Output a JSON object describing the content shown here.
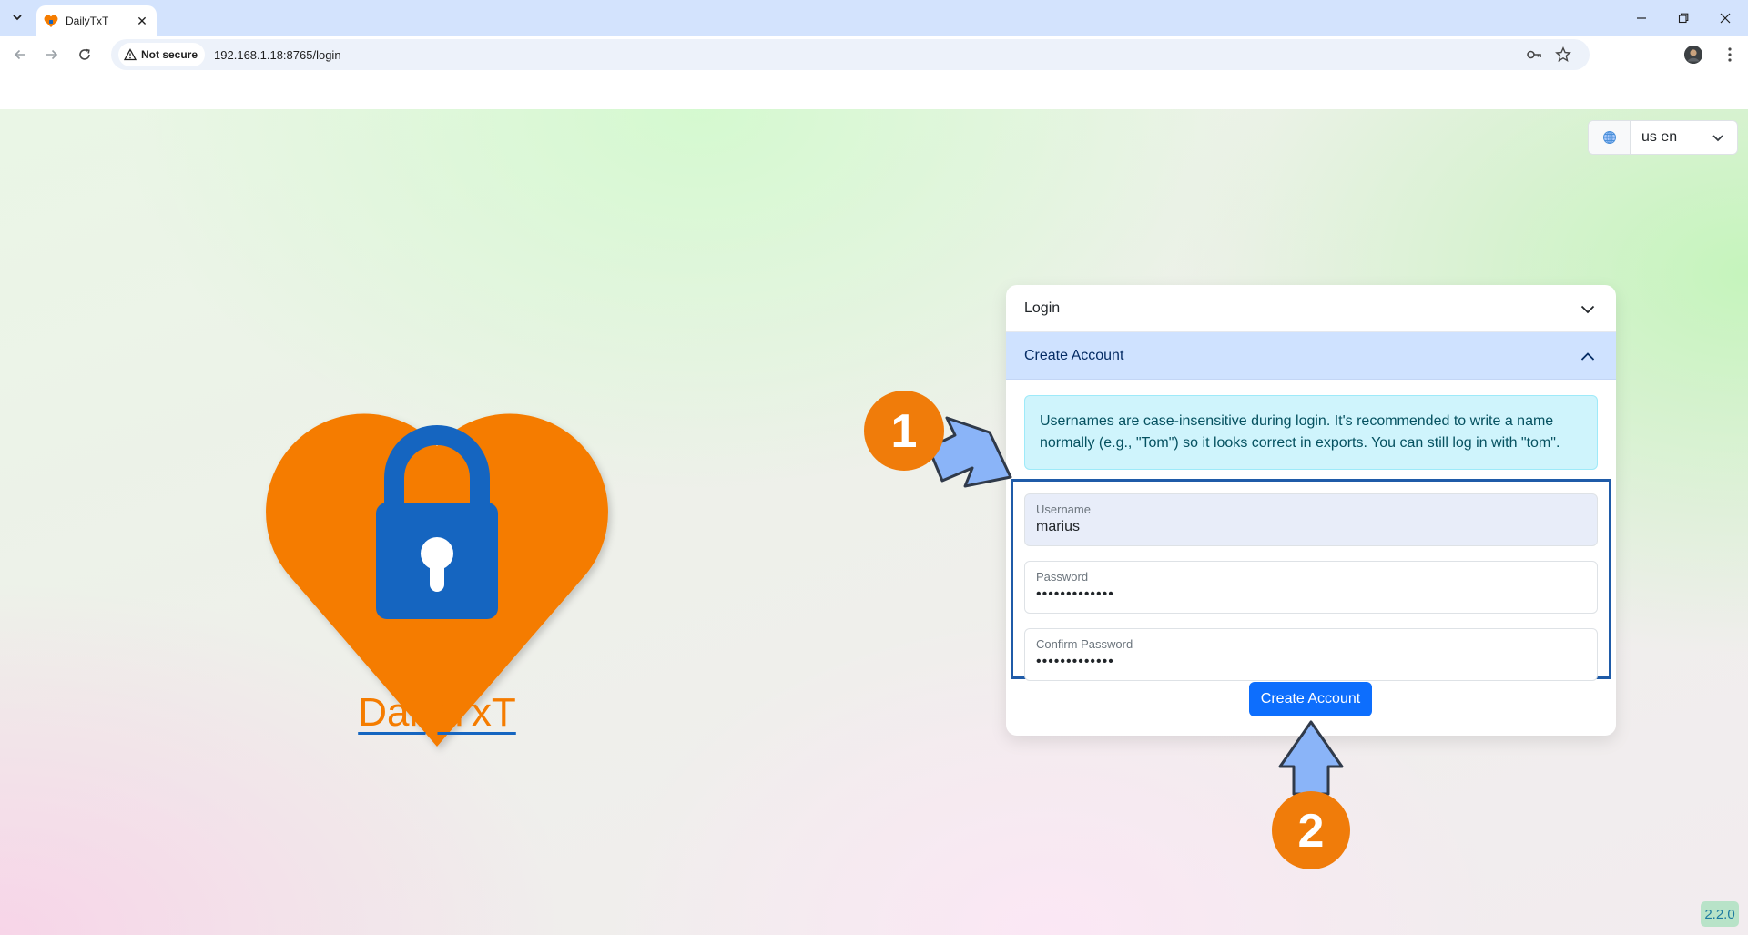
{
  "browser": {
    "tab_title": "DailyTxT",
    "security_label": "Not secure",
    "url": "192.168.1.18:8765/login"
  },
  "language": {
    "value": "us en"
  },
  "brand": {
    "name": "DailyTxT"
  },
  "auth": {
    "login_header": "Login",
    "create_header": "Create Account",
    "notice": "Usernames are case-insensitive during login. It's recommended to write a name normally (e.g., \"Tom\") so it looks correct in exports. You can still log in with \"tom\".",
    "username_label": "Username",
    "username_value": "marius",
    "password_label": "Password",
    "password_value": "•••••••••••••",
    "confirm_label": "Confirm Password",
    "confirm_value": "•••••••••••••",
    "submit_label": "Create Account"
  },
  "annotations": {
    "step1": "1",
    "step2": "2"
  },
  "version": "2.2.0",
  "colors": {
    "brand_orange": "#f57c00",
    "lock_blue": "#1565c0",
    "primary": "#0d6efd",
    "annotation_orange": "#f07c0a",
    "annotation_arrow": "#8ab4f8"
  }
}
